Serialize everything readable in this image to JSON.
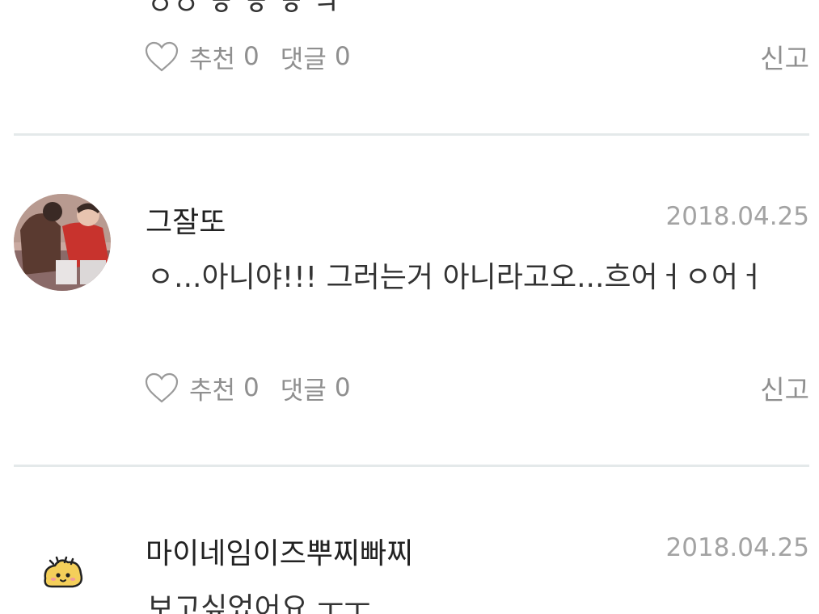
{
  "comments": [
    {
      "text_partial": "ㅇㅇ ㅎ ㅎ ㅎ ㅋ",
      "like_label": "추천",
      "like_count": "0",
      "reply_label": "댓글",
      "reply_count": "0",
      "report_label": "신고"
    },
    {
      "username": "그잘또",
      "date": "2018.04.25",
      "text": "ㅇ...아니야!!! 그러는거 아니라고오...흐어ㅓㅇ어ㅓ",
      "like_label": "추천",
      "like_count": "0",
      "reply_label": "댓글",
      "reply_count": "0",
      "report_label": "신고"
    },
    {
      "username": "마이네임이즈뿌찌빠찌",
      "date": "2018.04.25",
      "text_partial": "보고싶었어요 ㅜㅜ"
    }
  ],
  "icons": {
    "like": "heart-outline-icon",
    "avatar_emoji": "bread-emoji-icon"
  },
  "colors": {
    "muted_text": "#8f8f8f",
    "date_text": "#a3a3a3",
    "divider": "#e4e9ea"
  }
}
